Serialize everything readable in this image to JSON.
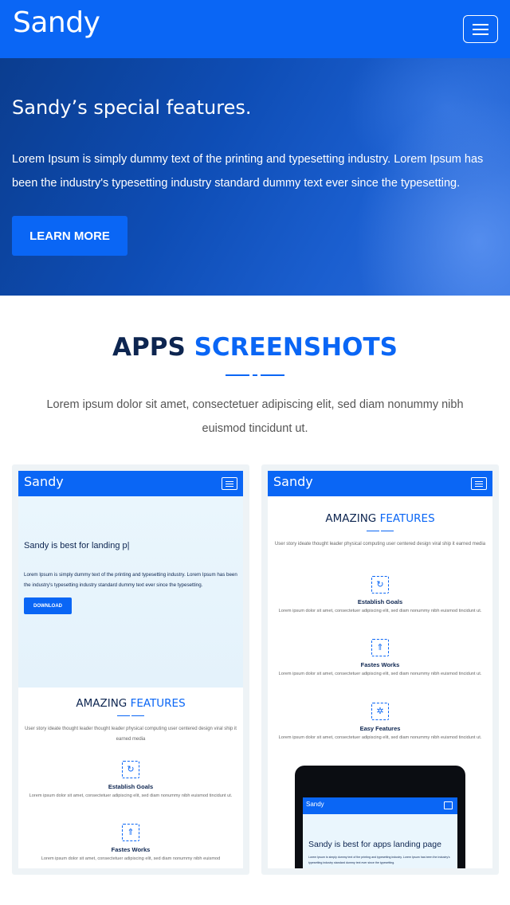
{
  "navbar": {
    "brand": "Sandy",
    "menu_icon": "hamburger-icon",
    "color": "#0a66f5"
  },
  "hero": {
    "title": "Sandy’s special features.",
    "text": "Lorem Ipsum is simply dummy text of the printing and typesetting industry. Lorem Ipsum has been the industry's typesetting industry standard dummy text ever since the typesetting.",
    "button": "LEARN MORE"
  },
  "screenshots_section": {
    "title_main": "APPS",
    "title_accent": "SCREENSHOTS",
    "subtitle": "Lorem ipsum dolor sit amet, consectetuer adipiscing elit, sed diam nonummy nibh euismod tincidunt ut."
  },
  "phone_a": {
    "brand": "Sandy",
    "hero_title": "Sandy is best for landing p|",
    "hero_text": "Lorem Ipsum is simply dummy text of the printing and typesetting industry. Lorem Ipsum has been the industry's typesetting industry standard dummy text ever since the typesetting.",
    "download": "DOWNLOAD",
    "features_title_main": "AMAZING",
    "features_title_accent": "FEATURES",
    "features_sub": "User story ideate thought leader thought leader physical computing user centered design viral ship it earned media",
    "features": [
      {
        "icon": "refresh-icon",
        "name": "Establish Goals",
        "text": "Lorem ipsum dolor sit amet, consectetuer adipiscing elit, sed diam nonummy nibh euismod tincidunt ut."
      },
      {
        "icon": "rocket-icon",
        "name": "Fastes Works",
        "text": "Lorem ipsum dolor sit amet, consectetuer adipiscing elit, sed diam nonummy nibh euismod"
      }
    ]
  },
  "phone_b": {
    "brand": "Sandy",
    "features_title_main": "AMAZING",
    "features_title_accent": "FEATURES",
    "features_sub": "User story ideate thought leader physical computing user centered design viral ship it earned media",
    "features": [
      {
        "icon": "refresh-icon",
        "name": "Establish Goals",
        "text": "Lorem ipsum dolor sit amet, consectetuer adipiscing elit, sed diam nonummy nibh euismod tincidunt ut."
      },
      {
        "icon": "rocket-icon",
        "name": "Fastes Works",
        "text": "Lorem ipsum dolor sit amet, consectetuer adipiscing elit, sed diam nonummy nibh euismod tincidunt ut."
      },
      {
        "icon": "gear-icon",
        "name": "Easy Features",
        "text": "Lorem ipsum dolor sit amet, consectetuer adipiscing elit, sed diam nonummy nibh euismod tincidunt ut."
      }
    ],
    "tablet": {
      "brand": "Sandy",
      "title": "Sandy is best for apps landing page",
      "text": "Lorem Ipsum is simply dummy text of the printing and typesetting industry. Lorem Ipsum has been the industry's typesetting industry standard dummy text ever since the typesetting."
    }
  }
}
